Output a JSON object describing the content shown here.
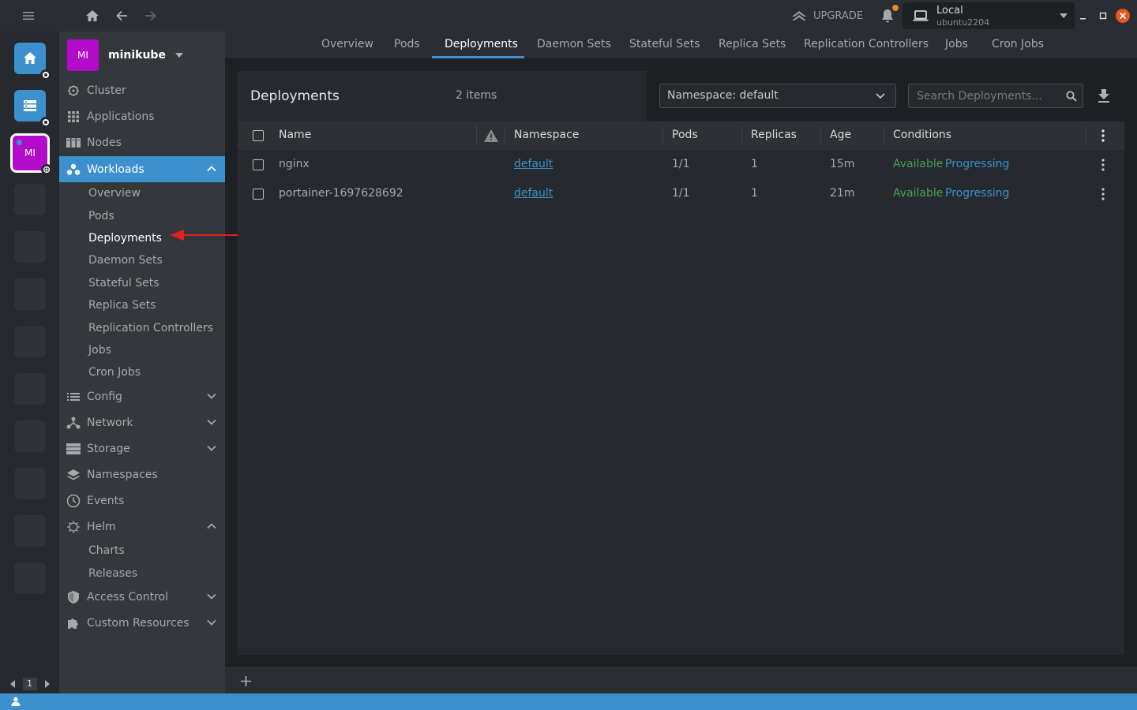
{
  "topbar": {
    "upgrade_label": "UPGRADE",
    "cluster_title": "Local",
    "cluster_subtitle": "ubuntu2204"
  },
  "hotbar": {
    "active_avatar_label": "MI",
    "page_number": "1"
  },
  "sidebar": {
    "cluster_avatar": "MI",
    "cluster_name": "minikube",
    "items": [
      {
        "label": "Cluster",
        "icon": "cluster-icon"
      },
      {
        "label": "Applications",
        "icon": "grid-icon"
      },
      {
        "label": "Nodes",
        "icon": "nodes-icon"
      },
      {
        "label": "Workloads",
        "icon": "workloads-icon"
      },
      {
        "label": "Config",
        "icon": "list-icon"
      },
      {
        "label": "Network",
        "icon": "network-icon"
      },
      {
        "label": "Storage",
        "icon": "storage-icon"
      },
      {
        "label": "Namespaces",
        "icon": "layers-icon"
      },
      {
        "label": "Events",
        "icon": "clock-icon"
      },
      {
        "label": "Helm",
        "icon": "helm-icon"
      },
      {
        "label": "Access Control",
        "icon": "shield-icon"
      },
      {
        "label": "Custom Resources",
        "icon": "puzzle-icon"
      }
    ],
    "workloads_sub": [
      "Overview",
      "Pods",
      "Deployments",
      "Daemon Sets",
      "Stateful Sets",
      "Replica Sets",
      "Replication Controllers",
      "Jobs",
      "Cron Jobs"
    ],
    "helm_sub": [
      "Charts",
      "Releases"
    ]
  },
  "tabs": [
    "Overview",
    "Pods",
    "Deployments",
    "Daemon Sets",
    "Stateful Sets",
    "Replica Sets",
    "Replication Controllers",
    "Jobs",
    "Cron Jobs"
  ],
  "panel": {
    "title": "Deployments",
    "count": "2 items",
    "namespace_select": "Namespace: default",
    "search_placeholder": "Search Deployments..."
  },
  "table": {
    "columns": [
      "Name",
      "Namespace",
      "Pods",
      "Replicas",
      "Age",
      "Conditions"
    ],
    "rows": [
      {
        "name": "nginx",
        "namespace": "default",
        "pods": "1/1",
        "replicas": "1",
        "age": "15m",
        "cond1": "Available",
        "cond2": "Progressing"
      },
      {
        "name": "portainer-1697628692",
        "namespace": "default",
        "pods": "1/1",
        "replicas": "1",
        "age": "21m",
        "cond1": "Available",
        "cond2": "Progressing"
      }
    ]
  },
  "colors": {
    "accent": "#3d90ce",
    "cluster_avatar": "#b40aca",
    "available": "#48a05d",
    "annotation_arrow": "#e02020"
  }
}
